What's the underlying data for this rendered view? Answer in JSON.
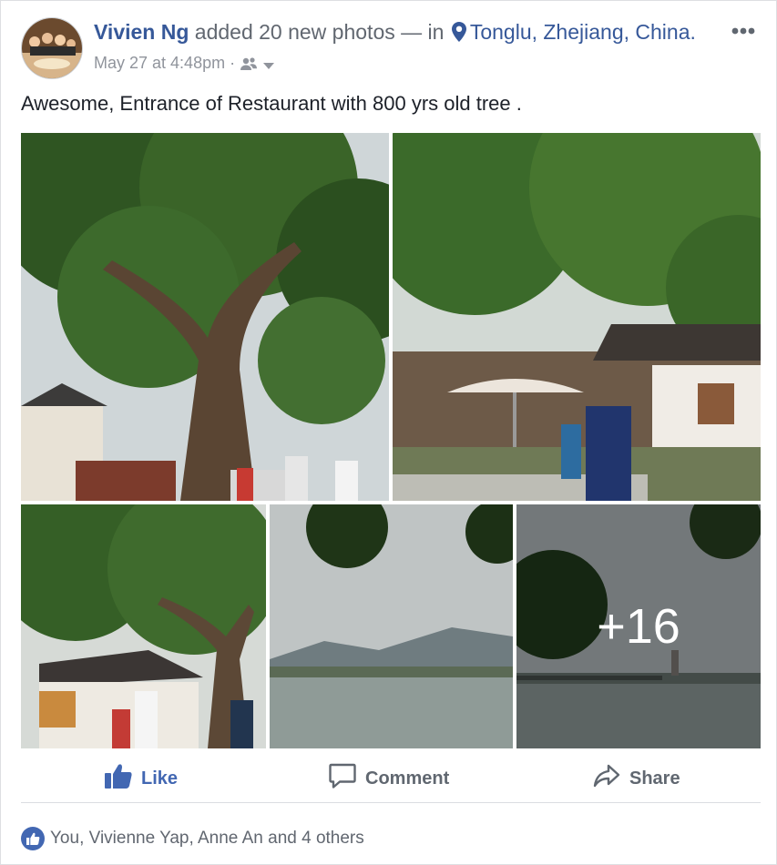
{
  "post": {
    "author": "Vivien Ng",
    "action_text": "added 20 new photos — in",
    "location": "Tonglu, Zhejiang, China.",
    "timestamp": "May 27 at 4:48pm",
    "separator": "·",
    "audience_icon": "friends-icon",
    "text": "Awesome, Entrance of Restaurant with 800 yrs old tree ."
  },
  "photos": {
    "more_count_label": "+16"
  },
  "actions": {
    "like_label": "Like",
    "comment_label": "Comment",
    "share_label": "Share"
  },
  "reactions": {
    "summary": "You, Vivienne Yap, Anne An and 4 others"
  },
  "colors": {
    "link_blue": "#365899",
    "like_blue": "#4267b2",
    "secondary_text": "#90949c"
  }
}
